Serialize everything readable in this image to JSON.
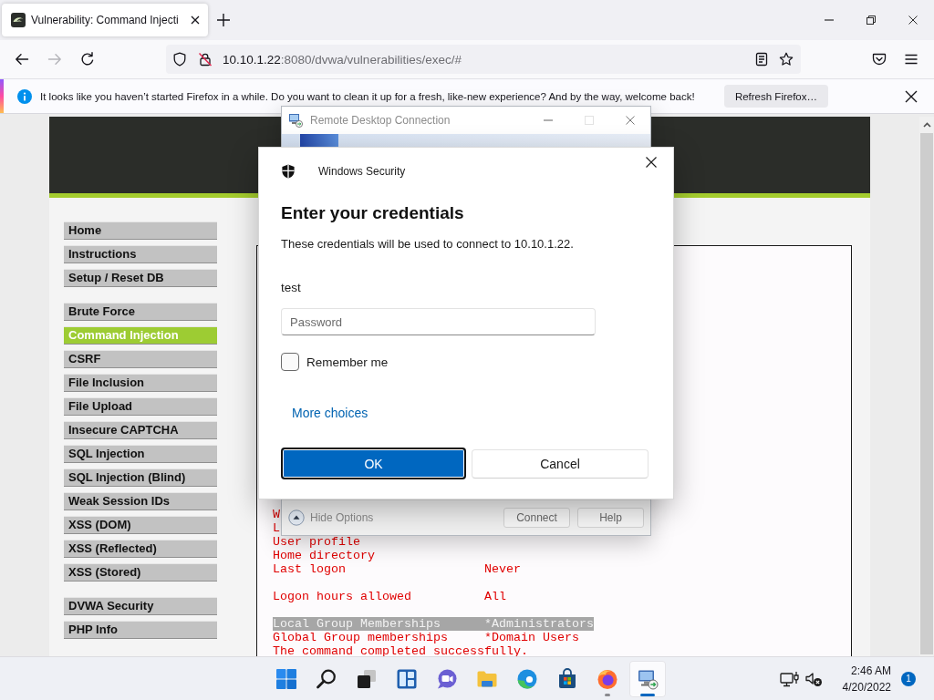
{
  "browser": {
    "tabs": [
      {
        "title": "Vulnerability: Command Injecti",
        "selected": true
      }
    ],
    "nav_buttons": [
      {
        "kind": "back",
        "disabled": false
      },
      {
        "kind": "forward",
        "disabled": true
      },
      {
        "kind": "reload",
        "disabled": false
      }
    ],
    "address": {
      "host": "10.10.1.22",
      "rest": ":8080/dvwa/vulnerabilities/exec/#"
    },
    "notification": {
      "message": "It looks like you haven’t started Firefox in a while. Do you want to clean it up for a fresh, like-new experience? And by the way, welcome back!",
      "button": "Refresh Firefox…"
    }
  },
  "dvwa": {
    "menu_groups": [
      {
        "items": [
          {
            "label": "Home",
            "selected": false
          },
          {
            "label": "Instructions",
            "selected": false
          },
          {
            "label": "Setup / Reset DB",
            "selected": false
          }
        ]
      },
      {
        "items": [
          {
            "label": "Brute Force",
            "selected": false
          },
          {
            "label": "Command Injection",
            "selected": true
          },
          {
            "label": "CSRF",
            "selected": false
          },
          {
            "label": "File Inclusion",
            "selected": false
          },
          {
            "label": "File Upload",
            "selected": false
          },
          {
            "label": "Insecure CAPTCHA",
            "selected": false
          },
          {
            "label": "SQL Injection",
            "selected": false
          },
          {
            "label": "SQL Injection (Blind)",
            "selected": false
          },
          {
            "label": "Weak Session IDs",
            "selected": false
          },
          {
            "label": "XSS (DOM)",
            "selected": false
          },
          {
            "label": "XSS (Reflected)",
            "selected": false
          },
          {
            "label": "XSS (Stored)",
            "selected": false
          }
        ]
      },
      {
        "items": [
          {
            "label": "DVWA Security",
            "selected": false
          },
          {
            "label": "PHP Info",
            "selected": false
          }
        ]
      }
    ],
    "output": {
      "blocks": [
        {
          "lines": [
            {
              "label": "W",
              "selected": false
            },
            {
              "label": "L",
              "selected": false
            },
            {
              "label": "User profile",
              "selected": false
            },
            {
              "label": "Home directory",
              "selected": false
            },
            {
              "label": "Last logon",
              "value": "Never",
              "selected": false
            }
          ]
        },
        {
          "lines": [
            {
              "label": "Logon hours allowed",
              "value": "All",
              "selected": false
            }
          ]
        },
        {
          "lines": [
            {
              "label": "Local Group Memberships",
              "value": "*Administrators",
              "selected": true
            },
            {
              "label": "Global Group memberships",
              "value": "*Domain Users",
              "selected": false
            },
            {
              "label": "The command completed successfully.",
              "selected": false
            }
          ]
        }
      ]
    }
  },
  "rdc_window": {
    "title": "Remote Desktop Connection",
    "active": false,
    "window_controls": [
      {
        "kind": "minimize",
        "disabled": false
      },
      {
        "kind": "maximize",
        "disabled": true
      },
      {
        "kind": "close",
        "disabled": false
      }
    ],
    "options_toggle": "Hide Options",
    "buttons": [
      "Connect",
      "Help"
    ]
  },
  "security_dialog": {
    "app": "Windows Security",
    "heading": "Enter your credentials",
    "message": "These credentials will be used to connect to 10.10.1.22.",
    "username": "test",
    "password": {
      "placeholder": "Password"
    },
    "remember_me": {
      "label": "Remember me",
      "checked": false
    },
    "link": "More choices",
    "buttons": [
      {
        "label": "OK",
        "kind": "primary"
      },
      {
        "label": "Cancel",
        "kind": "secondary"
      }
    ]
  },
  "taskbar": {
    "apps": [
      {
        "kind": "start",
        "running": false,
        "active": false
      },
      {
        "kind": "search",
        "running": false,
        "active": false
      },
      {
        "kind": "taskview",
        "running": false,
        "active": false
      },
      {
        "kind": "widgets",
        "running": false,
        "active": false
      },
      {
        "kind": "chat",
        "running": false,
        "active": false
      },
      {
        "kind": "explorer",
        "running": false,
        "active": false
      },
      {
        "kind": "edge",
        "running": false,
        "active": false
      },
      {
        "kind": "store",
        "running": false,
        "active": false
      },
      {
        "kind": "firefox",
        "running": true,
        "active": false
      },
      {
        "kind": "remote",
        "running": true,
        "active": true
      }
    ],
    "clock": {
      "time": "2:46 AM",
      "date": "4/20/2022"
    },
    "notification_count": "1"
  }
}
